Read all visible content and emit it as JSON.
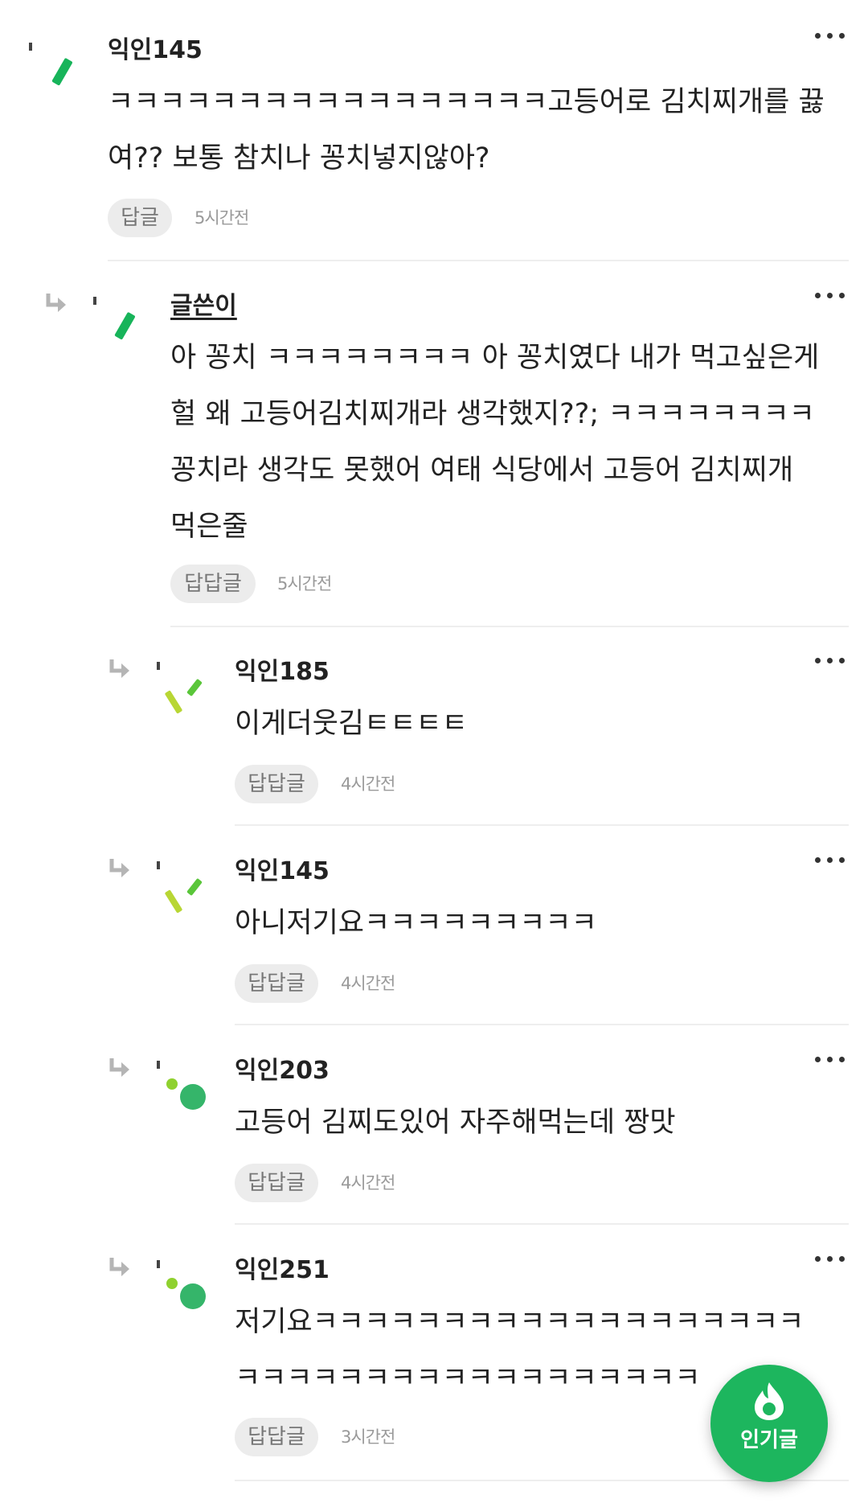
{
  "comments": [
    {
      "nickname": "익인145",
      "lines": [
        "ㅋㅋㅋㅋㅋㅋㅋㅋㅋㅋㅋㅋㅋㅋㅋㅋㅋ고등어로 김치찌개를 끓",
        "여?? 보통 참치나 꽁치넣지않아?"
      ],
      "reply_label": "답글",
      "time": "5시간전",
      "avatar_icon": "green-stick-avatar-icon"
    },
    {
      "nickname": "글쓴이",
      "lines": [
        "아 꽁치 ㅋㅋㅋㅋㅋㅋㅋㅋ 아 꽁치였다 내가 먹고싶은게",
        "헐 왜 고등어김치찌개라 생각했지??; ㅋㅋㅋㅋㅋㅋㅋㅋ",
        "꽁치라 생각도 못했어 여태 식당에서 고등어 김치찌개",
        "먹은줄"
      ],
      "reply_label": "답답글",
      "time": "5시간전",
      "avatar_icon": "green-stick-avatar-icon"
    },
    {
      "nickname": "익인185",
      "lines": [
        "이게더웃김ㅌㅌㅌㅌ"
      ],
      "reply_label": "답답글",
      "time": "4시간전",
      "avatar_icon": "yellow-green-sticks-avatar-icon"
    },
    {
      "nickname": "익인145",
      "lines": [
        "아니저기요ㅋㅋㅋㅋㅋㅋㅋㅋㅋ"
      ],
      "reply_label": "답답글",
      "time": "4시간전",
      "avatar_icon": "yellow-green-sticks-avatar-icon"
    },
    {
      "nickname": "익인203",
      "lines": [
        "고등어 김찌도있어 자주해먹는데 짱맛"
      ],
      "reply_label": "답답글",
      "time": "4시간전",
      "avatar_icon": "green-dots-avatar-icon"
    },
    {
      "nickname": "익인251",
      "lines": [
        "저기요ㅋㅋㅋㅋㅋㅋㅋㅋㅋㅋㅋㅋㅋㅋㅋㅋㅋㅋㅋ",
        "ㅋㅋㅋㅋㅋㅋㅋㅋㅋㅋㅋㅋㅋㅋㅋㅋㅋㅋ"
      ],
      "reply_label": "답답글",
      "time": "3시간전",
      "avatar_icon": "green-dots-avatar-icon"
    }
  ],
  "fab": {
    "label": "인기글",
    "icon": "flame-icon",
    "color": "#1db65e"
  },
  "colors": {
    "reply_button_bg": "#ececec",
    "divider": "#eeeeee"
  }
}
